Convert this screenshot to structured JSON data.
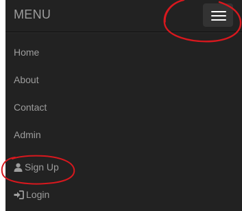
{
  "navbar": {
    "brand": "MENU",
    "toggle_icon": "hamburger-icon",
    "items": [
      {
        "label": "Home"
      },
      {
        "label": "About"
      },
      {
        "label": "Contact"
      },
      {
        "label": "Admin"
      },
      {
        "label": "Sign Up",
        "icon": "user-icon"
      },
      {
        "label": "Login",
        "icon": "login-icon"
      }
    ]
  },
  "colors": {
    "navbar_bg": "#222222",
    "text": "#9d9d9d",
    "toggle_bg": "#333333",
    "annotation": "#d8181e"
  }
}
